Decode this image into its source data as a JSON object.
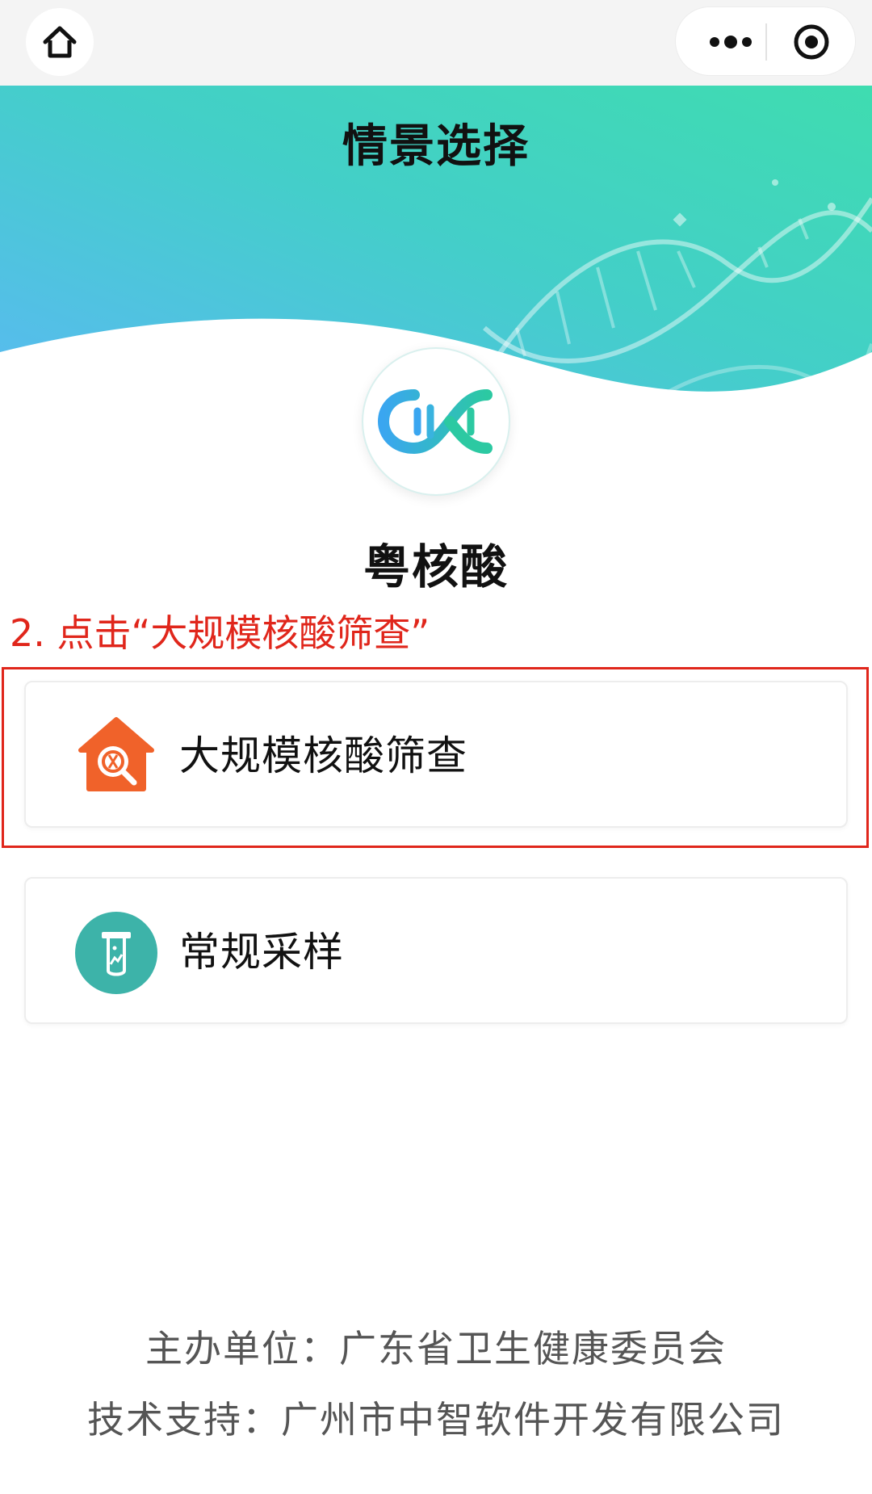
{
  "header": {
    "title": "情景选择"
  },
  "app": {
    "name": "粤核酸"
  },
  "instruction": {
    "text": "2. 点击“大规模核酸筛查”"
  },
  "options": [
    {
      "label": "大规模核酸筛查",
      "icon": "house-search-icon",
      "color": "#f0622a"
    },
    {
      "label": "常规采样",
      "icon": "test-tube-icon",
      "color": "#3db3a9"
    }
  ],
  "footer": {
    "organizer": "主办单位：广东省卫生健康委员会",
    "support": "技术支持：广州市中智软件开发有限公司"
  },
  "colors": {
    "accent_red": "#e0261b",
    "banner_start": "#5bb8f5",
    "banner_end": "#3fdcb0"
  }
}
